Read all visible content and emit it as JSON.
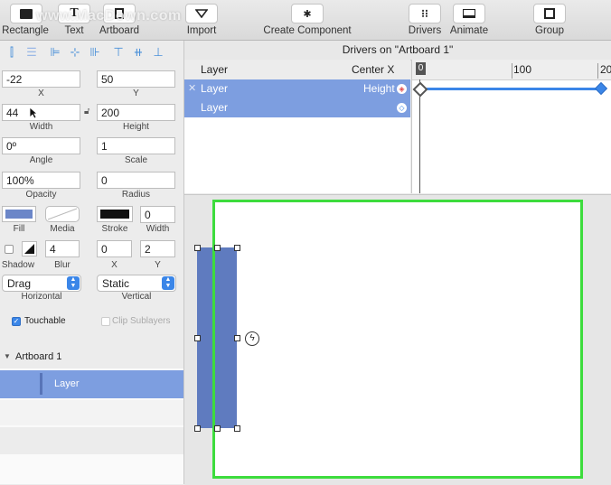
{
  "watermark": "www.MacDown.com",
  "toolbar": {
    "items": [
      {
        "label": "Rectangle"
      },
      {
        "label": "Text"
      },
      {
        "label": "Artboard"
      },
      {
        "label": "Import"
      },
      {
        "label": "Create Component"
      },
      {
        "label": "Drivers"
      },
      {
        "label": "Animate"
      },
      {
        "label": "Group"
      }
    ]
  },
  "inspector": {
    "x": {
      "label": "X",
      "value": "-22"
    },
    "y": {
      "label": "Y",
      "value": "50"
    },
    "width": {
      "label": "Width",
      "value": "44"
    },
    "height": {
      "label": "Height",
      "value": "200"
    },
    "angle": {
      "label": "Angle",
      "value": "0º"
    },
    "scale": {
      "label": "Scale",
      "value": "1"
    },
    "opacity": {
      "label": "Opacity",
      "value": "100%"
    },
    "radius": {
      "label": "Radius",
      "value": "0"
    },
    "fill": {
      "label": "Fill",
      "color": "#6b86c8"
    },
    "media": {
      "label": "Media"
    },
    "stroke": {
      "label": "Stroke",
      "color": "#111111"
    },
    "stroke_width": {
      "label": "Width",
      "value": "0"
    },
    "shadow": {
      "label": "Shadow",
      "blur_label": "Blur",
      "blur": "4",
      "x_label": "X",
      "x": "0",
      "y_label": "Y",
      "y": "2"
    },
    "horizontal": {
      "label": "Horizontal",
      "value": "Drag"
    },
    "vertical": {
      "label": "Vertical",
      "value": "Static"
    },
    "touchable": {
      "label": "Touchable",
      "checked": true
    },
    "clip_sublayers": {
      "label": "Clip Sublayers",
      "checked": false
    }
  },
  "layers": {
    "artboard": "Artboard 1",
    "layer": "Layer"
  },
  "drivers": {
    "title": "Drivers on \"Artboard 1\"",
    "col_layer": "Layer",
    "col_property": "Center X",
    "rows": [
      {
        "layer": "Layer",
        "property": "Height"
      },
      {
        "layer": "Layer",
        "property": ""
      }
    ],
    "ruler": [
      "0",
      "100",
      "20"
    ]
  },
  "colors": {
    "selection": "#7d9ee0",
    "artboard_border": "#3ddc3d",
    "accent": "#3b86e8"
  }
}
